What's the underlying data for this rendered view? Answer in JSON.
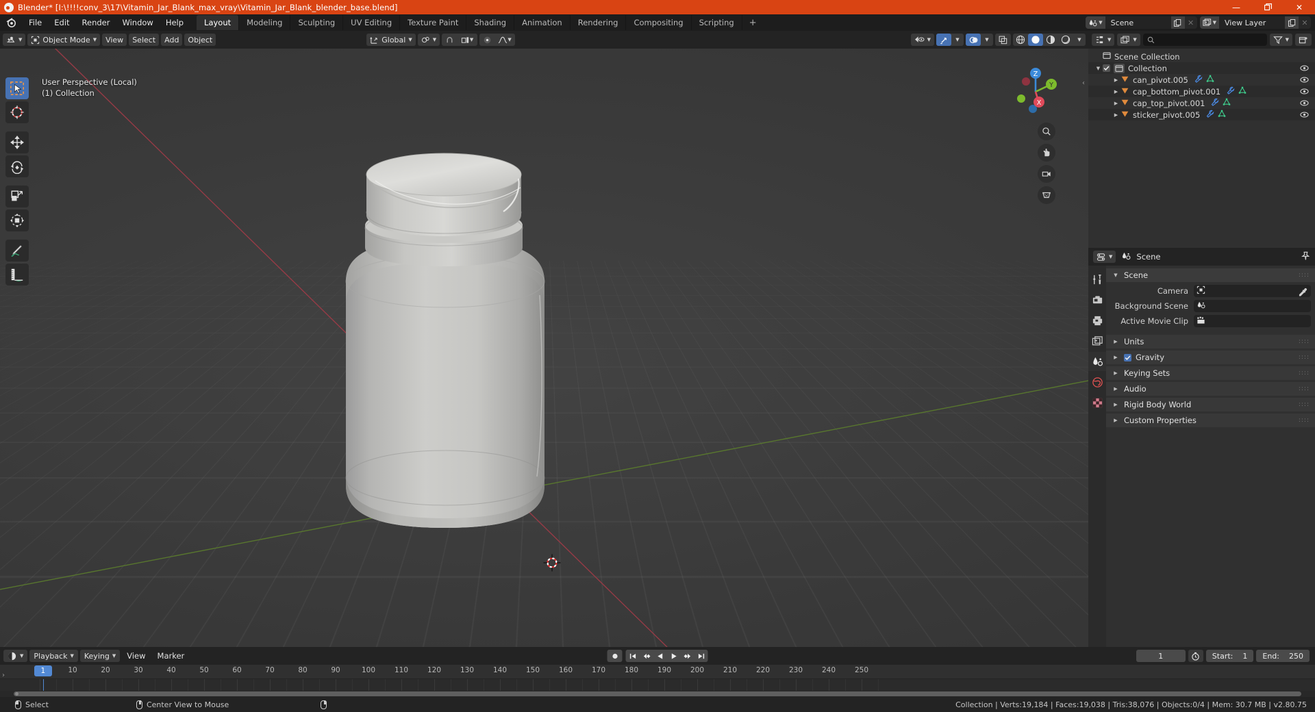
{
  "window": {
    "title": "Blender* [I:\\!!!!conv_3\\17\\Vitamin_Jar_Blank_max_vray\\Vitamin_Jar_Blank_blender_base.blend]",
    "app_icon": "blender-logo-icon",
    "controls": {
      "minimize": "—",
      "maximize": "❐",
      "close": "✕"
    },
    "accent_color": "#d94413"
  },
  "topbar": {
    "menus": [
      "File",
      "Edit",
      "Render",
      "Window",
      "Help"
    ],
    "workspaces": [
      {
        "label": "Layout",
        "active": true
      },
      {
        "label": "Modeling",
        "active": false
      },
      {
        "label": "Sculpting",
        "active": false
      },
      {
        "label": "UV Editing",
        "active": false
      },
      {
        "label": "Texture Paint",
        "active": false
      },
      {
        "label": "Shading",
        "active": false
      },
      {
        "label": "Animation",
        "active": false
      },
      {
        "label": "Rendering",
        "active": false
      },
      {
        "label": "Compositing",
        "active": false
      },
      {
        "label": "Scripting",
        "active": false
      }
    ],
    "add_workspace": "+",
    "scene": {
      "icon": "scene-icon",
      "value": "Scene",
      "new_icon": "copy-icon",
      "unlink_icon": "✕"
    },
    "view_layer": {
      "icon": "view-layer-icon",
      "value": "View Layer",
      "new_icon": "copy-icon",
      "unlink_icon": "✕"
    }
  },
  "viewport": {
    "mode": "Object Mode",
    "menus": [
      "View",
      "Select",
      "Add",
      "Object"
    ],
    "transform_orientation": "Global",
    "overlay_text_line1": "User Perspective (Local)",
    "overlay_text_line2": "(1) Collection",
    "gizmo_axes": [
      "Z",
      "Y",
      "X"
    ],
    "tools": [
      {
        "name": "tweak-select-box-tool",
        "active": true
      },
      {
        "name": "cursor-tool",
        "active": false
      },
      {
        "name": "move-tool",
        "active": false
      },
      {
        "name": "rotate-tool",
        "active": false
      },
      {
        "name": "scale-tool",
        "active": false
      },
      {
        "name": "transform-tool",
        "active": false
      },
      {
        "name": "annotate-tool",
        "active": false
      },
      {
        "name": "measure-tool",
        "active": false
      }
    ],
    "shading_modes": [
      "wireframe",
      "solid",
      "material-preview",
      "rendered"
    ],
    "active_shading": "solid"
  },
  "outliner": {
    "display_mode_icon": "outliner-icon",
    "filter_icon": "filter-icon",
    "new_collection_icon": "new-collection-icon",
    "search_placeholder": "",
    "rows": [
      {
        "label": "Scene Collection",
        "indent": 0,
        "icon": "collection-icon",
        "has_toggle": false,
        "has_tri": false,
        "mods": [],
        "eye": false
      },
      {
        "label": "Collection",
        "indent": 1,
        "icon": "collection-icon",
        "has_toggle": true,
        "has_tri": true,
        "mods": [],
        "eye": true
      },
      {
        "label": "can_pivot.005",
        "indent": 2,
        "icon": "empty-axis-icon",
        "has_toggle": false,
        "has_tri": true,
        "mods": [
          "modifier-icon",
          "mesh-data-icon"
        ],
        "eye": true
      },
      {
        "label": "cap_bottom_pivot.001",
        "indent": 2,
        "icon": "empty-axis-icon",
        "has_toggle": false,
        "has_tri": true,
        "mods": [
          "modifier-icon",
          "mesh-data-icon"
        ],
        "eye": true
      },
      {
        "label": "cap_top_pivot.001",
        "indent": 2,
        "icon": "empty-axis-icon",
        "has_toggle": false,
        "has_tri": true,
        "mods": [
          "modifier-icon",
          "mesh-data-icon"
        ],
        "eye": true
      },
      {
        "label": "sticker_pivot.005",
        "indent": 2,
        "icon": "empty-axis-icon",
        "has_toggle": false,
        "has_tri": true,
        "mods": [
          "modifier-icon",
          "mesh-data-icon"
        ],
        "eye": true
      }
    ]
  },
  "properties": {
    "editor_icon": "properties-editor-icon",
    "breadcrumb_icon": "scene-icon",
    "breadcrumb": "Scene",
    "pin_icon": "pin-icon",
    "tabs": [
      {
        "name": "tool-tab",
        "icon": "tool-icon",
        "active": false
      },
      {
        "name": "render-tab",
        "icon": "render-camera-icon",
        "active": false
      },
      {
        "name": "output-tab",
        "icon": "printer-icon",
        "active": false
      },
      {
        "name": "view-layer-tab",
        "icon": "images-icon",
        "active": false
      },
      {
        "name": "scene-tab",
        "icon": "scene-icon",
        "active": true
      },
      {
        "name": "world-tab",
        "icon": "world-icon",
        "active": false
      },
      {
        "name": "texture-tab",
        "icon": "checker-icon",
        "active": false
      }
    ],
    "panels": [
      {
        "label": "Scene",
        "open": true,
        "checkbox": null
      },
      {
        "label": "Units",
        "open": false,
        "checkbox": null
      },
      {
        "label": "Gravity",
        "open": false,
        "checkbox": true
      },
      {
        "label": "Keying Sets",
        "open": false,
        "checkbox": null
      },
      {
        "label": "Audio",
        "open": false,
        "checkbox": null
      },
      {
        "label": "Rigid Body World",
        "open": false,
        "checkbox": null
      },
      {
        "label": "Custom Properties",
        "open": false,
        "checkbox": null
      }
    ],
    "fields": [
      {
        "label": "Camera",
        "value": "",
        "icon": "camera-icon",
        "trailing_icon": "eyedropper-icon"
      },
      {
        "label": "Background Scene",
        "value": "",
        "icon": "scene-icon",
        "trailing_icon": null
      },
      {
        "label": "Active Movie Clip",
        "value": "",
        "icon": "movie-clip-icon",
        "trailing_icon": null
      }
    ]
  },
  "timeline": {
    "editor_icon": "timeline-icon",
    "menus": [
      "Playback",
      "Keying",
      "View",
      "Marker"
    ],
    "transport": [
      "record",
      "jump-start",
      "prev-keyframe",
      "play-reverse",
      "play",
      "next-keyframe",
      "jump-end"
    ],
    "current_frame": "1",
    "start_label": "Start:",
    "start_value": "1",
    "end_label": "End:",
    "end_value": "250",
    "auto_key_icon": "stopwatch-icon",
    "ticks": [
      10,
      20,
      30,
      40,
      50,
      60,
      70,
      80,
      90,
      100,
      110,
      120,
      130,
      140,
      150,
      160,
      170,
      180,
      190,
      200,
      210,
      220,
      230,
      240,
      250
    ],
    "playhead_frame": "1"
  },
  "statusbar": {
    "left_items": [
      {
        "icon": "mouse-left-icon",
        "label": "Select"
      },
      {
        "icon": "mouse-middle-icon",
        "label": "Center View to Mouse"
      },
      {
        "icon": "mouse-right-icon",
        "label": ""
      }
    ],
    "stats": "Collection | Verts:19,184 | Faces:19,038 | Tris:38,076 | Objects:0/4 | Mem: 30.7 MB | v2.80.75"
  },
  "scene_object": {
    "description": "vitamin jar with flip-top cap, light grey plastic, solid shading"
  }
}
